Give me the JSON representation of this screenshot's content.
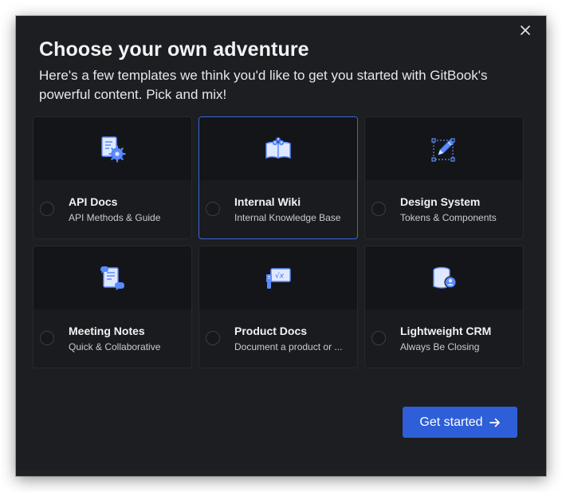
{
  "dialog": {
    "title": "Choose your own adventure",
    "subtitle": "Here's a few templates we think you'd like to get you started with GitBook's powerful content. Pick and mix!",
    "close_icon": "close-icon"
  },
  "templates": [
    {
      "title": "API Docs",
      "description": "API Methods & Guide",
      "icon": "document-gear-icon",
      "selected": false
    },
    {
      "title": "Internal Wiki",
      "description": "Internal Knowledge Base",
      "icon": "open-book-people-icon",
      "selected": true
    },
    {
      "title": "Design System",
      "description": "Tokens & Components",
      "icon": "pencil-frame-icon",
      "selected": false
    },
    {
      "title": "Meeting Notes",
      "description": "Quick & Collaborative",
      "icon": "notes-chat-icon",
      "selected": false
    },
    {
      "title": "Product Docs",
      "description": "Document a product or ...",
      "icon": "formula-board-icon",
      "selected": false
    },
    {
      "title": "Lightweight CRM",
      "description": "Always Be Closing",
      "icon": "database-user-icon",
      "selected": false
    }
  ],
  "cta": {
    "label": "Get started",
    "icon": "arrow-right-icon"
  },
  "colors": {
    "accent": "#2e5fd9",
    "selected_border": "#3a66dd",
    "modal_bg": "#1d1e21",
    "card_bg": "#1a1b1e"
  }
}
